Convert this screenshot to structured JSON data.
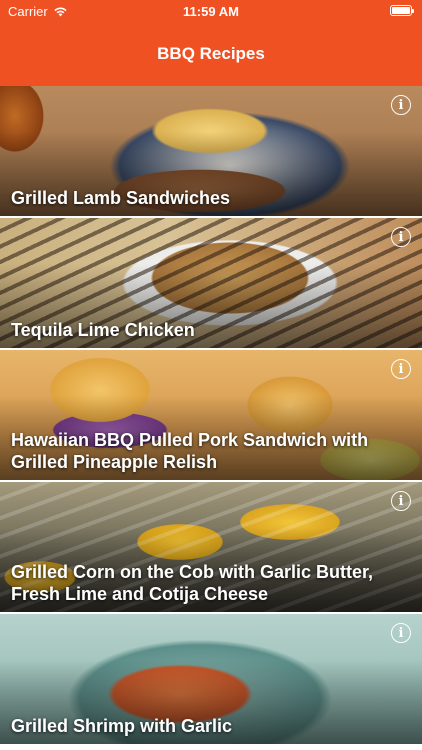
{
  "status_bar": {
    "carrier": "Carrier",
    "time": "11:59 AM",
    "battery_level": 1.0
  },
  "nav": {
    "title": "BBQ Recipes"
  },
  "colors": {
    "brand": "#f05123",
    "text_on_brand": "#ffffff"
  },
  "recipes": [
    {
      "title": "Grilled Lamb Sandwiches",
      "info_icon": "info-circle-icon"
    },
    {
      "title": "Tequila Lime Chicken",
      "info_icon": "info-circle-icon"
    },
    {
      "title": "Hawaiian BBQ Pulled Pork Sandwich with Grilled Pineapple Relish",
      "info_icon": "info-circle-icon"
    },
    {
      "title": "Grilled Corn on the Cob with Garlic Butter, Fresh Lime and Cotija Cheese",
      "info_icon": "info-circle-icon"
    },
    {
      "title": "Grilled Shrimp with Garlic",
      "info_icon": "info-circle-icon"
    }
  ]
}
